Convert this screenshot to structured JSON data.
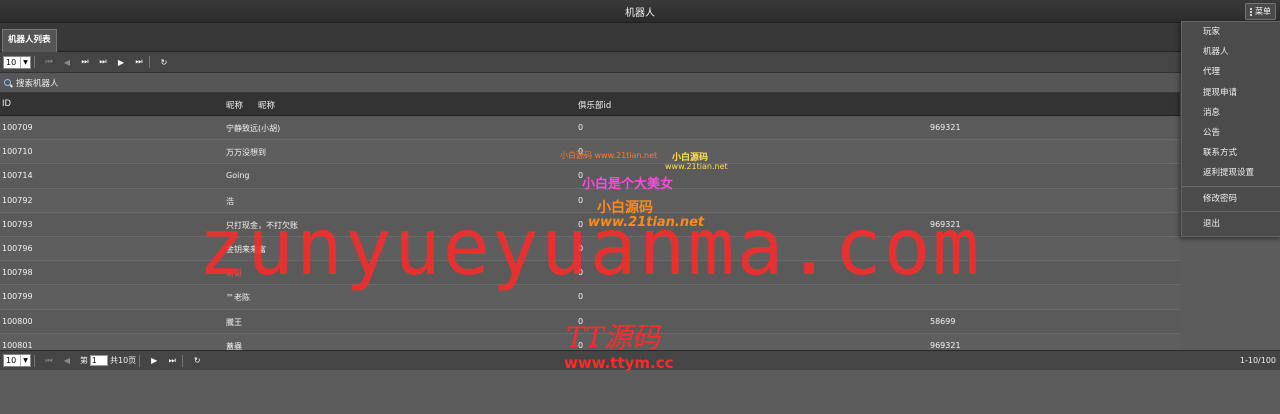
{
  "app": {
    "title": "机器人",
    "menu_label": "菜单"
  },
  "tabs": [
    {
      "label": "机器人列表"
    }
  ],
  "toolbar": {
    "page_size": "10"
  },
  "search": {
    "label": "搜索机器人"
  },
  "columns": {
    "id": "ID",
    "nickname_a": "昵称",
    "nickname_b": "昵称",
    "club_id": "俱乐部id"
  },
  "rows": [
    {
      "id": "100709",
      "name": "宁静致远(小胡)",
      "club": "0",
      "extra": "969321",
      "red": false
    },
    {
      "id": "100710",
      "name": "万万没想到",
      "club": "0",
      "extra": "",
      "red": false
    },
    {
      "id": "100714",
      "name": "Going",
      "club": "0",
      "extra": "",
      "red": false
    },
    {
      "id": "100792",
      "name": "浩",
      "club": "0",
      "extra": "",
      "red": false
    },
    {
      "id": "100793",
      "name": "只打现金，不打欠账",
      "club": "0",
      "extra": "969321",
      "red": false
    },
    {
      "id": "100796",
      "name": "金钥来来富",
      "club": "0",
      "extra": "",
      "red": false
    },
    {
      "id": "100798",
      "name": "新哥",
      "club": "0",
      "extra": "",
      "red": true
    },
    {
      "id": "100799",
      "name": "™老陈",
      "club": "0",
      "extra": "",
      "red": false
    },
    {
      "id": "100800",
      "name": "騰王",
      "club": "0",
      "extra": "58699",
      "red": false
    },
    {
      "id": "100801",
      "name": "蓋蟲",
      "club": "0",
      "extra": "969321",
      "red": false
    }
  ],
  "footer": {
    "page_size": "10",
    "page_prefix": "第",
    "page_value": "1",
    "page_suffix": "共10页",
    "range": "1-10/100"
  },
  "menu": {
    "items": [
      "玩家",
      "机器人",
      "代理",
      "提现申请",
      "消息",
      "公告",
      "联系方式",
      "返利提现设置"
    ],
    "change_password": "修改密码",
    "logout": "退出"
  },
  "watermarks": {
    "main": "zunyueyuanma.com",
    "ttym_cn": "TT源码",
    "ttym_url": "www.ttym.cc",
    "s1": "小白源码 www.21tian.net",
    "s2": "小白源码",
    "s3": "www.21tian.net",
    "s4": "小白是个大美女",
    "s5": "小白源码",
    "s6": "www.21tian.net"
  }
}
